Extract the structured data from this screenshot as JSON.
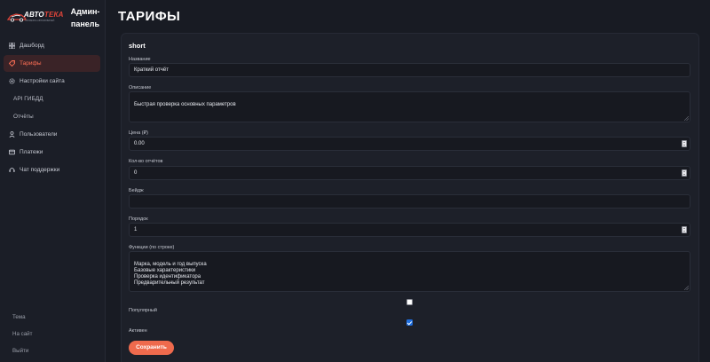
{
  "brand": {
    "logo_part1": "АВТО",
    "logo_part2": "ТЕКА",
    "logo_tagline": "ПРОВЕРКА АВТОМОБИЛЕЙ",
    "title": "Админ-панель"
  },
  "sidebar": {
    "items": [
      {
        "label": "Дашборд",
        "icon": "grid-icon"
      },
      {
        "label": "Тарифы",
        "icon": "tag-icon",
        "active": true
      },
      {
        "label": "Настройки сайта",
        "icon": "gear-icon"
      },
      {
        "label": "API ГИБДД"
      },
      {
        "label": "Отчёты"
      },
      {
        "label": "Пользователи",
        "icon": "user-icon"
      },
      {
        "label": "Платежи",
        "icon": "card-icon"
      },
      {
        "label": "Чат поддержки",
        "icon": "headset-icon"
      }
    ],
    "bottom": [
      "Тема",
      "На сайт",
      "Выйти"
    ]
  },
  "page": {
    "title": "ТАРИФЫ"
  },
  "form": {
    "card_title": "short",
    "name_label": "Название",
    "name_value": "Краткий отчёт",
    "description_label": "Описание",
    "description_value": "Быстрая проверка основных параметров",
    "price_label": "Цена (₽)",
    "price_value": "0.00",
    "reports_label": "Кол-во отчётов",
    "reports_value": "0",
    "badge_label": "Бейдж",
    "badge_value": "",
    "order_label": "Порядок",
    "order_value": "1",
    "functions_label": "Функции (по строке)",
    "functions_value": "Марка, модель и год выпуска\nБазовые характеристики\nПроверка идентификатора\nПредварительный результат",
    "popular_label": "Популярный",
    "popular_checked": false,
    "active_label": "Активен",
    "active_checked": true,
    "save_label": "Сохранить"
  },
  "colors": {
    "accent": "#ef6a4d",
    "active_nav_bg": "#3a2327",
    "checkbox_on": "#1f6fe0",
    "background": "#181b23"
  }
}
